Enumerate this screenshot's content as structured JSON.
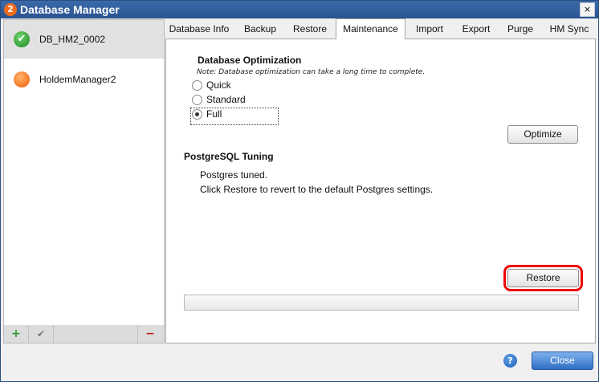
{
  "window": {
    "title": "Database Manager",
    "app_icon": "2",
    "close_glyph": "×"
  },
  "sidebar": {
    "items": [
      {
        "label": "DB_HM2_0002",
        "icon": "green-check-icon",
        "glyph": "✔",
        "selected": true
      },
      {
        "label": "HoldemManager2",
        "icon": "orange-dot-icon",
        "selected": false
      }
    ],
    "toolbar": {
      "add": "+",
      "check": "✔",
      "remove": "−"
    }
  },
  "tabs": [
    {
      "label": "Database Info"
    },
    {
      "label": "Backup"
    },
    {
      "label": "Restore"
    },
    {
      "label": "Maintenance",
      "active": true
    },
    {
      "label": "Import"
    },
    {
      "label": "Export"
    },
    {
      "label": "Purge"
    },
    {
      "label": "HM Sync"
    }
  ],
  "maintenance": {
    "optimization": {
      "title": "Database Optimization",
      "note": "Note: Database optimization can take a long time to complete.",
      "options": [
        "Quick",
        "Standard",
        "Full"
      ],
      "selected": "Full",
      "optimize_label": "Optimize"
    },
    "tuning": {
      "title": "PostgreSQL Tuning",
      "status": "Postgres tuned.",
      "hint": "Click Restore to revert to the default Postgres settings.",
      "restore_label": "Restore"
    }
  },
  "footer": {
    "help_glyph": "?",
    "close_label": "Close"
  },
  "colors": {
    "title_bar": "#2a5391",
    "highlight_ring": "#e00000",
    "primary_button": "#2f6fc5"
  }
}
